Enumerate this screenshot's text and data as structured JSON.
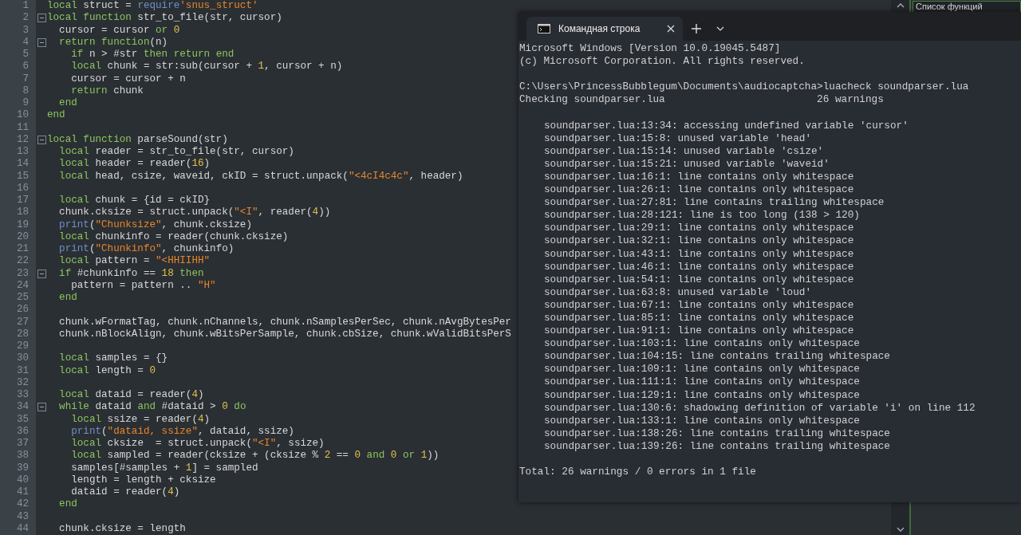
{
  "editor": {
    "lines": [
      {
        "number": "1",
        "fold": false,
        "tokens": [
          {
            "kind": "kw",
            "text": "local"
          },
          {
            "kind": "plain",
            "text": " struct = "
          },
          {
            "kind": "fn",
            "text": "require"
          },
          {
            "kind": "str",
            "text": "'snus_struct'"
          }
        ]
      },
      {
        "number": "2",
        "fold": true,
        "tokens": [
          {
            "kind": "kw",
            "text": "local function"
          },
          {
            "kind": "plain",
            "text": " str_to_file(str, cursor)"
          }
        ]
      },
      {
        "number": "3",
        "fold": false,
        "tokens": [
          {
            "kind": "plain",
            "text": "  cursor = cursor "
          },
          {
            "kind": "kw",
            "text": "or"
          },
          {
            "kind": "num",
            "text": " 0"
          }
        ]
      },
      {
        "number": "4",
        "fold": true,
        "tokens": [
          {
            "kind": "kw",
            "text": "  return function"
          },
          {
            "kind": "plain",
            "text": "(n)"
          }
        ]
      },
      {
        "number": "5",
        "fold": false,
        "tokens": [
          {
            "kind": "kw",
            "text": "    if"
          },
          {
            "kind": "plain",
            "text": " n > #str "
          },
          {
            "kind": "kw",
            "text": "then return end"
          }
        ]
      },
      {
        "number": "6",
        "fold": false,
        "tokens": [
          {
            "kind": "kw",
            "text": "    local"
          },
          {
            "kind": "plain",
            "text": " chunk = str:sub(cursor + "
          },
          {
            "kind": "num",
            "text": "1"
          },
          {
            "kind": "plain",
            "text": ", cursor + n)"
          }
        ]
      },
      {
        "number": "7",
        "fold": false,
        "tokens": [
          {
            "kind": "plain",
            "text": "    cursor = cursor + n"
          }
        ]
      },
      {
        "number": "8",
        "fold": false,
        "tokens": [
          {
            "kind": "kw",
            "text": "    return"
          },
          {
            "kind": "plain",
            "text": " chunk"
          }
        ]
      },
      {
        "number": "9",
        "fold": false,
        "tokens": [
          {
            "kind": "kw",
            "text": "  end"
          }
        ]
      },
      {
        "number": "10",
        "fold": false,
        "tokens": [
          {
            "kind": "kw",
            "text": "end"
          }
        ]
      },
      {
        "number": "11",
        "fold": false
      },
      {
        "number": "12",
        "fold": true,
        "tokens": [
          {
            "kind": "kw",
            "text": "local function"
          },
          {
            "kind": "plain",
            "text": " parseSound(str)"
          }
        ]
      },
      {
        "number": "13",
        "fold": false,
        "tokens": [
          {
            "kind": "kw",
            "text": "  local"
          },
          {
            "kind": "plain",
            "text": " reader = str_to_file(str, cursor)"
          }
        ]
      },
      {
        "number": "14",
        "fold": false,
        "tokens": [
          {
            "kind": "kw",
            "text": "  local"
          },
          {
            "kind": "plain",
            "text": " header = reader("
          },
          {
            "kind": "num",
            "text": "16"
          },
          {
            "kind": "plain",
            "text": ")"
          }
        ]
      },
      {
        "number": "15",
        "fold": false,
        "tokens": [
          {
            "kind": "kw",
            "text": "  local"
          },
          {
            "kind": "plain",
            "text": " head, csize, waveid, ckID = struct.unpack("
          },
          {
            "kind": "str",
            "text": "\"<4cI4c4c\""
          },
          {
            "kind": "plain",
            "text": ", header)"
          }
        ]
      },
      {
        "number": "16",
        "fold": false
      },
      {
        "number": "17",
        "fold": false,
        "tokens": [
          {
            "kind": "kw",
            "text": "  local"
          },
          {
            "kind": "plain",
            "text": " chunk = {id = ckID}"
          }
        ]
      },
      {
        "number": "18",
        "fold": false,
        "tokens": [
          {
            "kind": "plain",
            "text": "  chunk.cksize = struct.unpack("
          },
          {
            "kind": "str",
            "text": "\"<I\""
          },
          {
            "kind": "plain",
            "text": ", reader("
          },
          {
            "kind": "num",
            "text": "4"
          },
          {
            "kind": "plain",
            "text": "))"
          }
        ]
      },
      {
        "number": "19",
        "fold": false,
        "tokens": [
          {
            "kind": "fn",
            "text": "  print"
          },
          {
            "kind": "plain",
            "text": "("
          },
          {
            "kind": "str",
            "text": "\"Chunksize\""
          },
          {
            "kind": "plain",
            "text": ", chunk.cksize)"
          }
        ]
      },
      {
        "number": "20",
        "fold": false,
        "tokens": [
          {
            "kind": "kw",
            "text": "  local"
          },
          {
            "kind": "plain",
            "text": " chunkinfo = reader(chunk.cksize)"
          }
        ]
      },
      {
        "number": "21",
        "fold": false,
        "tokens": [
          {
            "kind": "fn",
            "text": "  print"
          },
          {
            "kind": "plain",
            "text": "("
          },
          {
            "kind": "str",
            "text": "\"Chunkinfo\""
          },
          {
            "kind": "plain",
            "text": ", chunkinfo)"
          }
        ]
      },
      {
        "number": "22",
        "fold": false,
        "tokens": [
          {
            "kind": "kw",
            "text": "  local"
          },
          {
            "kind": "plain",
            "text": " pattern = "
          },
          {
            "kind": "str",
            "text": "\"<HHIIHH\""
          }
        ]
      },
      {
        "number": "23",
        "fold": true,
        "tokens": [
          {
            "kind": "kw",
            "text": "  if"
          },
          {
            "kind": "plain",
            "text": " #chunkinfo == "
          },
          {
            "kind": "num",
            "text": "18"
          },
          {
            "kind": "kw",
            "text": " then"
          }
        ]
      },
      {
        "number": "24",
        "fold": false,
        "tokens": [
          {
            "kind": "plain",
            "text": "    pattern = pattern .. "
          },
          {
            "kind": "str",
            "text": "\"H\""
          }
        ]
      },
      {
        "number": "25",
        "fold": false,
        "tokens": [
          {
            "kind": "kw",
            "text": "  end"
          }
        ]
      },
      {
        "number": "26",
        "fold": false
      },
      {
        "number": "27",
        "fold": false,
        "tokens": [
          {
            "kind": "plain",
            "text": "  chunk.wFormatTag, chunk.nChannels, chunk.nSamplesPerSec, chunk.nAvgBytesPer"
          }
        ]
      },
      {
        "number": "28",
        "fold": false,
        "tokens": [
          {
            "kind": "plain",
            "text": "  chunk.nBlockAlign, chunk.wBitsPerSample, chunk.cbSize, chunk.wValidBitsPerS"
          }
        ]
      },
      {
        "number": "29",
        "fold": false
      },
      {
        "number": "30",
        "fold": false,
        "tokens": [
          {
            "kind": "kw",
            "text": "  local"
          },
          {
            "kind": "plain",
            "text": " samples = {}"
          }
        ]
      },
      {
        "number": "31",
        "fold": false,
        "tokens": [
          {
            "kind": "kw",
            "text": "  local"
          },
          {
            "kind": "plain",
            "text": " length = "
          },
          {
            "kind": "num",
            "text": "0"
          }
        ]
      },
      {
        "number": "32",
        "fold": false
      },
      {
        "number": "33",
        "fold": false,
        "tokens": [
          {
            "kind": "kw",
            "text": "  local"
          },
          {
            "kind": "plain",
            "text": " dataid = reader("
          },
          {
            "kind": "num",
            "text": "4"
          },
          {
            "kind": "plain",
            "text": ")"
          }
        ]
      },
      {
        "number": "34",
        "fold": true,
        "tokens": [
          {
            "kind": "kw",
            "text": "  while"
          },
          {
            "kind": "plain",
            "text": " dataid "
          },
          {
            "kind": "kw",
            "text": "and"
          },
          {
            "kind": "plain",
            "text": " #dataid > "
          },
          {
            "kind": "num",
            "text": "0"
          },
          {
            "kind": "kw",
            "text": " do"
          }
        ]
      },
      {
        "number": "35",
        "fold": false,
        "tokens": [
          {
            "kind": "kw",
            "text": "    local"
          },
          {
            "kind": "plain",
            "text": " ssize = reader("
          },
          {
            "kind": "num",
            "text": "4"
          },
          {
            "kind": "plain",
            "text": ")"
          }
        ]
      },
      {
        "number": "36",
        "fold": false,
        "tokens": [
          {
            "kind": "fn",
            "text": "    print"
          },
          {
            "kind": "plain",
            "text": "("
          },
          {
            "kind": "str",
            "text": "\"dataid, ssize\""
          },
          {
            "kind": "plain",
            "text": ", dataid, ssize)"
          }
        ]
      },
      {
        "number": "37",
        "fold": false,
        "tokens": [
          {
            "kind": "kw",
            "text": "    local"
          },
          {
            "kind": "plain",
            "text": " cksize  = struct.unpack("
          },
          {
            "kind": "str",
            "text": "\"<I\""
          },
          {
            "kind": "plain",
            "text": ", ssize)"
          }
        ]
      },
      {
        "number": "38",
        "fold": false,
        "tokens": [
          {
            "kind": "kw",
            "text": "    local"
          },
          {
            "kind": "plain",
            "text": " sampled = reader(cksize + (cksize % "
          },
          {
            "kind": "num",
            "text": "2"
          },
          {
            "kind": "plain",
            "text": " == "
          },
          {
            "kind": "num",
            "text": "0"
          },
          {
            "kind": "kw",
            "text": " and"
          },
          {
            "kind": "num",
            "text": " 0"
          },
          {
            "kind": "kw",
            "text": " or"
          },
          {
            "kind": "num",
            "text": " 1"
          },
          {
            "kind": "plain",
            "text": "))"
          }
        ]
      },
      {
        "number": "39",
        "fold": false,
        "tokens": [
          {
            "kind": "plain",
            "text": "    samples[#samples + "
          },
          {
            "kind": "num",
            "text": "1"
          },
          {
            "kind": "plain",
            "text": "] = sampled"
          }
        ]
      },
      {
        "number": "40",
        "fold": false,
        "tokens": [
          {
            "kind": "plain",
            "text": "    length = length + cksize"
          }
        ]
      },
      {
        "number": "41",
        "fold": false,
        "tokens": [
          {
            "kind": "plain",
            "text": "    dataid = reader("
          },
          {
            "kind": "num",
            "text": "4"
          },
          {
            "kind": "plain",
            "text": ")"
          }
        ]
      },
      {
        "number": "42",
        "fold": false,
        "tokens": [
          {
            "kind": "kw",
            "text": "  end"
          }
        ]
      },
      {
        "number": "43",
        "fold": false
      },
      {
        "number": "44",
        "fold": false,
        "tokens": [
          {
            "kind": "plain",
            "text": "  chunk.cksize = length"
          }
        ]
      }
    ]
  },
  "function_list": {
    "title": "Список функций"
  },
  "terminal": {
    "tab": {
      "title": "Командная строка",
      "selected": true
    },
    "lines": [
      {
        "kind": "text",
        "text": "Microsoft Windows [Version 10.0.19045.5487]"
      },
      {
        "kind": "text",
        "text": "(c) Microsoft Corporation. All rights reserved."
      },
      {
        "kind": "blank"
      },
      {
        "kind": "text",
        "text": "C:\\Users\\PrincessBubblegum\\Documents\\audiocaptcha>luacheck soundparser.lua"
      },
      {
        "kind": "text",
        "text": "Checking soundparser.lua                         26 warnings"
      },
      {
        "kind": "blank"
      },
      {
        "kind": "warning",
        "text": "soundparser.lua:13:34: accessing undefined variable 'cursor'"
      },
      {
        "kind": "warning",
        "text": "soundparser.lua:15:8: unused variable 'head'"
      },
      {
        "kind": "warning",
        "text": "soundparser.lua:15:14: unused variable 'csize'"
      },
      {
        "kind": "warning",
        "text": "soundparser.lua:15:21: unused variable 'waveid'"
      },
      {
        "kind": "warning",
        "text": "soundparser.lua:16:1: line contains only whitespace"
      },
      {
        "kind": "warning",
        "text": "soundparser.lua:26:1: line contains only whitespace"
      },
      {
        "kind": "warning",
        "text": "soundparser.lua:27:81: line contains trailing whitespace"
      },
      {
        "kind": "warning",
        "text": "soundparser.lua:28:121: line is too long (138 > 120)"
      },
      {
        "kind": "warning",
        "text": "soundparser.lua:29:1: line contains only whitespace"
      },
      {
        "kind": "warning",
        "text": "soundparser.lua:32:1: line contains only whitespace"
      },
      {
        "kind": "warning",
        "text": "soundparser.lua:43:1: line contains only whitespace"
      },
      {
        "kind": "warning",
        "text": "soundparser.lua:46:1: line contains only whitespace"
      },
      {
        "kind": "warning",
        "text": "soundparser.lua:54:1: line contains only whitespace"
      },
      {
        "kind": "warning",
        "text": "soundparser.lua:63:8: unused variable 'loud'"
      },
      {
        "kind": "warning",
        "text": "soundparser.lua:67:1: line contains only whitespace"
      },
      {
        "kind": "warning",
        "text": "soundparser.lua:85:1: line contains only whitespace"
      },
      {
        "kind": "warning",
        "text": "soundparser.lua:91:1: line contains only whitespace"
      },
      {
        "kind": "warning",
        "text": "soundparser.lua:103:1: line contains only whitespace"
      },
      {
        "kind": "warning",
        "text": "soundparser.lua:104:15: line contains trailing whitespace"
      },
      {
        "kind": "warning",
        "text": "soundparser.lua:109:1: line contains only whitespace"
      },
      {
        "kind": "warning",
        "text": "soundparser.lua:111:1: line contains only whitespace"
      },
      {
        "kind": "warning",
        "text": "soundparser.lua:129:1: line contains only whitespace"
      },
      {
        "kind": "warning",
        "text": "soundparser.lua:130:6: shadowing definition of variable 'i' on line 112"
      },
      {
        "kind": "warning",
        "text": "soundparser.lua:133:1: line contains only whitespace"
      },
      {
        "kind": "warning",
        "text": "soundparser.lua:138:26: line contains trailing whitespace"
      },
      {
        "kind": "warning",
        "text": "soundparser.lua:139:26: line contains trailing whitespace"
      },
      {
        "kind": "blank"
      },
      {
        "kind": "text",
        "text": "Total: 26 warnings / 0 errors in 1 file"
      }
    ]
  }
}
